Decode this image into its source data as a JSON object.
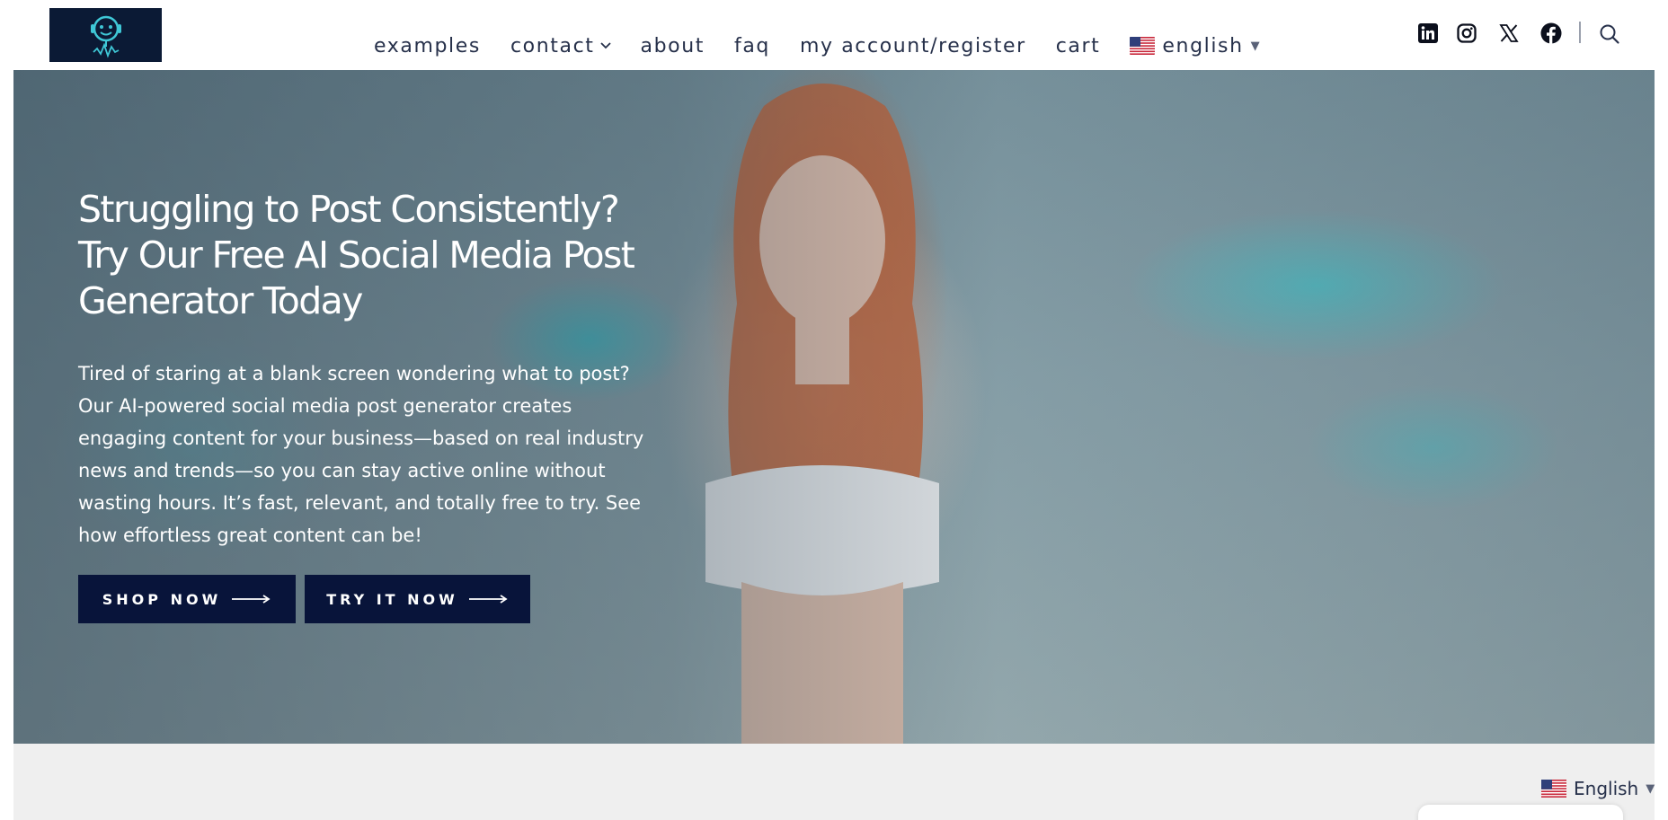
{
  "header": {
    "logo_icon": "robot-headset-logo",
    "nav": [
      {
        "label": "examples"
      },
      {
        "label": "contact",
        "icon": "chevron-down-icon"
      },
      {
        "label": "about"
      },
      {
        "label": "faq"
      },
      {
        "label": "my account/register"
      },
      {
        "label": "cart"
      }
    ],
    "language": {
      "label": "english",
      "flag": "us-flag-icon"
    },
    "social": [
      "linkedin-icon",
      "instagram-icon",
      "x-icon",
      "facebook-icon"
    ],
    "search_icon": "search-icon"
  },
  "hero": {
    "title": "Struggling to Post Consistently? Try Our Free AI Social Media Post Generator Today",
    "text": "Tired of staring at a blank screen wondering what to post? Our AI-powered social media post generator creates engaging content for your business—based on real industry news and trends—so you can stay active online without wasting hours. It’s fast, relevant, and totally free to try. See how effortless great content can be!",
    "buttons": [
      {
        "label": "SHOP NOW"
      },
      {
        "label": "TRY IT NOW"
      }
    ]
  },
  "footer_language": {
    "label": "English",
    "flag": "us-flag-icon"
  },
  "colors": {
    "button_bg": "#08143a",
    "nav_text": "#26304a",
    "logo_bg": "#0b1a35",
    "accent_cyan": "#3fc7d6"
  }
}
